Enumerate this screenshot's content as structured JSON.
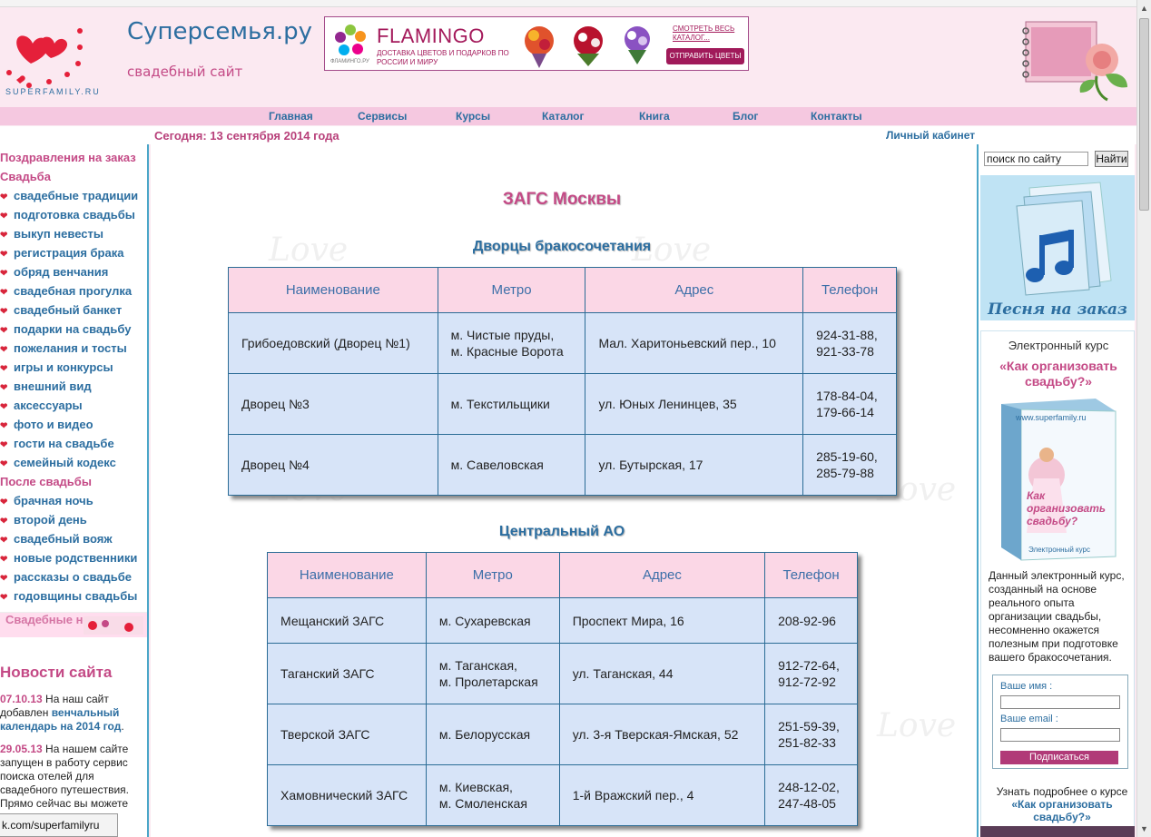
{
  "site": {
    "title": "Суперсемья.ру",
    "subtitle": "свадебный сайт",
    "logo_text": "SUPERFAMILY.RU"
  },
  "banner": {
    "brand": "FLAMINGO",
    "tagline": "ДОСТАВКА ЦВЕТОВ И ПОДАРКОВ ПО РОССИИ И МИРУ",
    "small": "ФЛАМИНГО.РУ",
    "look": "СМОТРЕТЬ ВЕСЬ КАТАЛОГ...",
    "send": "ОТПРАВИТЬ ЦВЕТЫ"
  },
  "nav": {
    "items": [
      "Главная",
      "Сервисы",
      "Курсы",
      "Каталог",
      "Книга",
      "Блог",
      "Контакты"
    ]
  },
  "dateline": {
    "today": "Сегодня: 13 сентября 2014 года",
    "cabinet": "Личный кабинет"
  },
  "left": {
    "cat_congrats": "Поздравления на заказ",
    "cat_wedding": "Свадьба",
    "wedding_items": [
      "свадебные традиции",
      "подготовка свадьбы",
      "выкуп невесты",
      "регистрация брака",
      "обряд венчания",
      "свадебная прогулка",
      "свадебный банкет",
      "подарки на свадьбу",
      "пожелания и тосты",
      "игры и конкурсы",
      "внешний вид",
      "аксессуары",
      "фото и видео",
      "гости на свадьбе",
      "семейный кодекс"
    ],
    "cat_after": "После свадьбы",
    "after_items": [
      "брачная ночь",
      "второй день",
      "свадебный вояж",
      "новые родственники",
      "рассказы о свадьбе",
      "годовщины свадьбы"
    ],
    "news_banner": "Свадебные новости",
    "news_title": "Новости сайта",
    "news": [
      {
        "date": "07.10.13",
        "text": " На наш сайт добавлен ",
        "link": "венчальный календарь на 2014 год",
        "tail": "."
      },
      {
        "date": "29.05.13",
        "text": " На нашем сайте запущен в работу сервис поиска отелей для свадебного путешествия. Прямо сейчас вы можете",
        "link": "",
        "tail": ""
      }
    ]
  },
  "status_bar": "k.com/superfamilyru",
  "main": {
    "title": "ЗАГС Москвы",
    "watermark": "Love",
    "columns": [
      "Наименование",
      "Метро",
      "Адрес",
      "Телефон"
    ],
    "palaces": {
      "title": "Дворцы бракосочетания",
      "rows": [
        {
          "name": "Грибоедовский (Дворец №1)",
          "metro1": "м. Чистые пруды,",
          "metro2": "м. Красные Ворота",
          "address": "Мал. Харитоньевский пер., 10",
          "phone1": "924-31-88,",
          "phone2": "921-33-78"
        },
        {
          "name": "Дворец №3",
          "metro1": "м. Текстильщики",
          "metro2": "",
          "address": "ул. Юных Ленинцев, 35",
          "phone1": "178-84-04,",
          "phone2": "179-66-14"
        },
        {
          "name": "Дворец №4",
          "metro1": "м. Савеловская",
          "metro2": "",
          "address": "ул. Бутырская, 17",
          "phone1": "285-19-60,",
          "phone2": "285-79-88"
        }
      ]
    },
    "central": {
      "title": "Центральный АО",
      "rows": [
        {
          "name": "Мещанский ЗАГС",
          "metro1": "м. Сухаревская",
          "metro2": "",
          "address": "Проспект Мира, 16",
          "phone1": "208-92-96",
          "phone2": ""
        },
        {
          "name": "Таганский ЗАГС",
          "metro1": "м. Таганская,",
          "metro2": "м. Пролетарская",
          "address": "ул. Таганская, 44",
          "phone1": "912-72-64,",
          "phone2": "912-72-92"
        },
        {
          "name": "Тверской ЗАГС",
          "metro1": "м. Белорусская",
          "metro2": "",
          "address": "ул. 3-я Тверская-Ямская, 52",
          "phone1": "251-59-39,",
          "phone2": "251-82-33"
        },
        {
          "name": "Хамовнический ЗАГС",
          "metro1": "м. Киевская,",
          "metro2": "м. Смоленская",
          "address": "1-й Вражский пер., 4",
          "phone1": "248-12-02,",
          "phone2": "247-48-05"
        }
      ]
    }
  },
  "right": {
    "search_placeholder": "поиск по сайту",
    "search_button": "Найти",
    "song": "Песня на заказ",
    "course_kicker": "Электронный курс",
    "course_name": "«Как организовать свадьбу?»",
    "book_url": "www.superfamily.ru",
    "book_title": "Как организовать свадьбу?",
    "book_foot": "Электронный курс",
    "course_desc": "Данный электронный курс, созданный на основе реального опыта организации свадьбы, несомненно окажется полезным при подготовке вашего бракосочетания.",
    "form_name": "Ваше имя :",
    "form_email": "Ваше email :",
    "form_button": "Подписаться",
    "more_text": "Узнать подробнее о курсе",
    "more_link": "«Как организовать свадьбу?»"
  }
}
